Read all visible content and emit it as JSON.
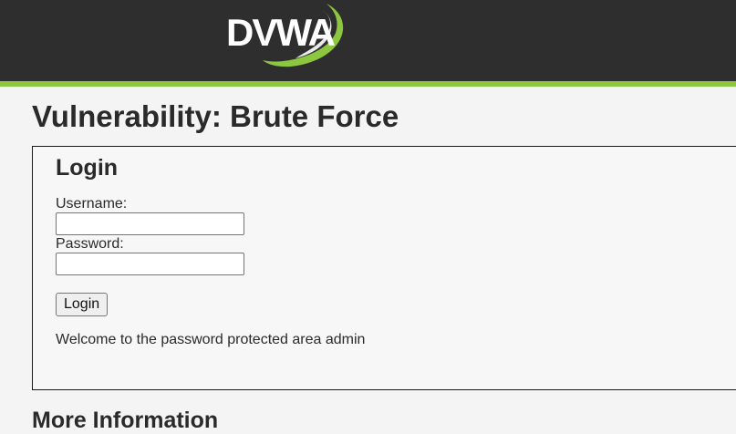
{
  "header": {
    "logo_text": "DVWA"
  },
  "colors": {
    "header_bg": "#2e2e2e",
    "accent": "#8dc63f",
    "page_bg": "#f4f4f4"
  },
  "main": {
    "title": "Vulnerability: Brute Force",
    "login_form": {
      "heading": "Login",
      "username_label": "Username:",
      "username_value": "",
      "password_label": "Password:",
      "password_value": "",
      "submit_label": "Login"
    },
    "message": "Welcome to the password protected area admin",
    "next_section_title": "More Information"
  }
}
